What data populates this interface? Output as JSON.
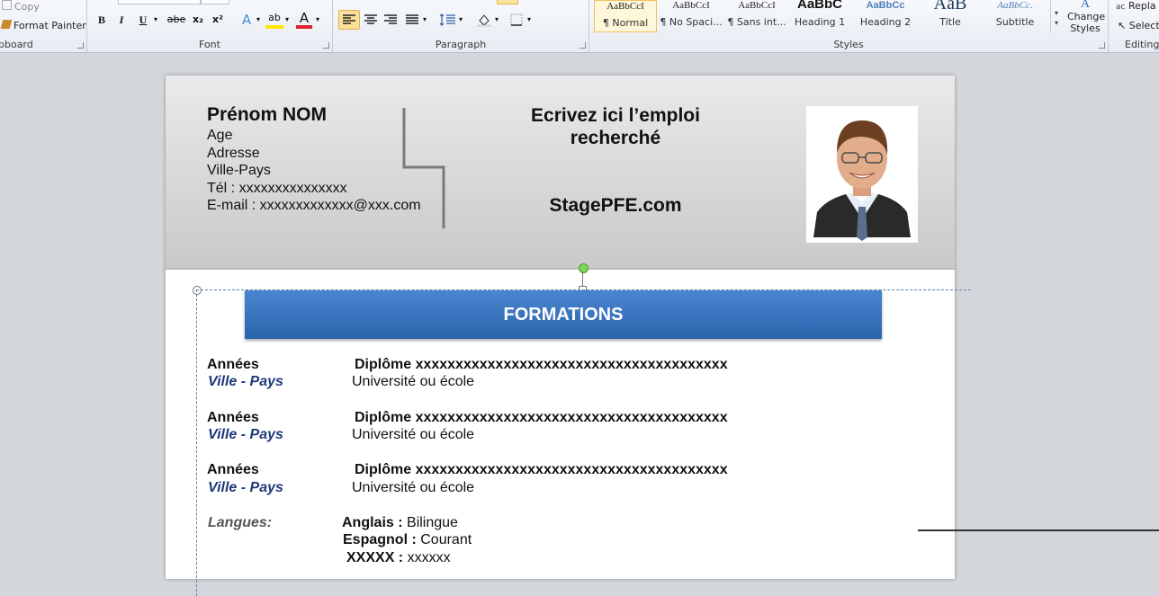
{
  "ribbon": {
    "clipboard": {
      "copy_label": "Copy",
      "format_painter_label": "Format Painter",
      "group_label": "pboard"
    },
    "font": {
      "group_label": "Font",
      "buttons": {
        "bold": "B",
        "italic": "I",
        "underline": "U",
        "strike": "abe",
        "subscript": "x₂",
        "superscript": "x²",
        "text_effect": "A",
        "highlight": "ab",
        "font_color": "A"
      }
    },
    "paragraph": {
      "group_label": "Paragraph"
    },
    "styles": {
      "group_label": "Styles",
      "items": [
        {
          "preview": "AaBbCcI",
          "name": "¶ Normal"
        },
        {
          "preview": "AaBbCcI",
          "name": "¶ No Spaci..."
        },
        {
          "preview": "AaBbCcI",
          "name": "¶ Sans int..."
        },
        {
          "preview": "AaBbC",
          "name": "Heading 1"
        },
        {
          "preview": "AaBbCc",
          "name": "Heading 2"
        },
        {
          "preview": "AaB",
          "name": "Title"
        },
        {
          "preview": "AaBbCc.",
          "name": "Subtitle"
        }
      ],
      "change_styles_label": "Change Styles"
    },
    "editing": {
      "replace_label": "Repla",
      "select_label": "Select",
      "group_label": "Editing"
    }
  },
  "cv": {
    "name": "Prénom NOM",
    "age": "Age",
    "address": "Adresse",
    "city": "Ville-Pays",
    "phone": "Tél  : xxxxxxxxxxxxxxx",
    "email": "E-mail  : xxxxxxxxxxxxx@xxx.com",
    "job_line1": "Ecrivez ici l’emploi",
    "job_line2": "recherché",
    "site": "StagePFE.com",
    "section_title": "FORMATIONS",
    "formations": [
      {
        "years": "Années",
        "place": "Ville - Pays",
        "diploma": "Diplôme xxxxxxxxxxxxxxxxxxxxxxxxxxxxxxxxxxxxxxx",
        "school": "Université ou école"
      },
      {
        "years": "Années",
        "place": "Ville - Pays",
        "diploma": "Diplôme xxxxxxxxxxxxxxxxxxxxxxxxxxxxxxxxxxxxxxx",
        "school": "Université ou école"
      },
      {
        "years": "Années",
        "place": "Ville - Pays",
        "diploma": "Diplôme xxxxxxxxxxxxxxxxxxxxxxxxxxxxxxxxxxxxxxx",
        "school": "Université ou école"
      }
    ],
    "languages_label": "Langues:",
    "languages": [
      {
        "lang": "Anglais :",
        "level": "Bilingue"
      },
      {
        "lang": "Espagnol :",
        "level": "Courant"
      },
      {
        "lang": "XXXXX :",
        "level": "xxxxxx"
      }
    ]
  }
}
